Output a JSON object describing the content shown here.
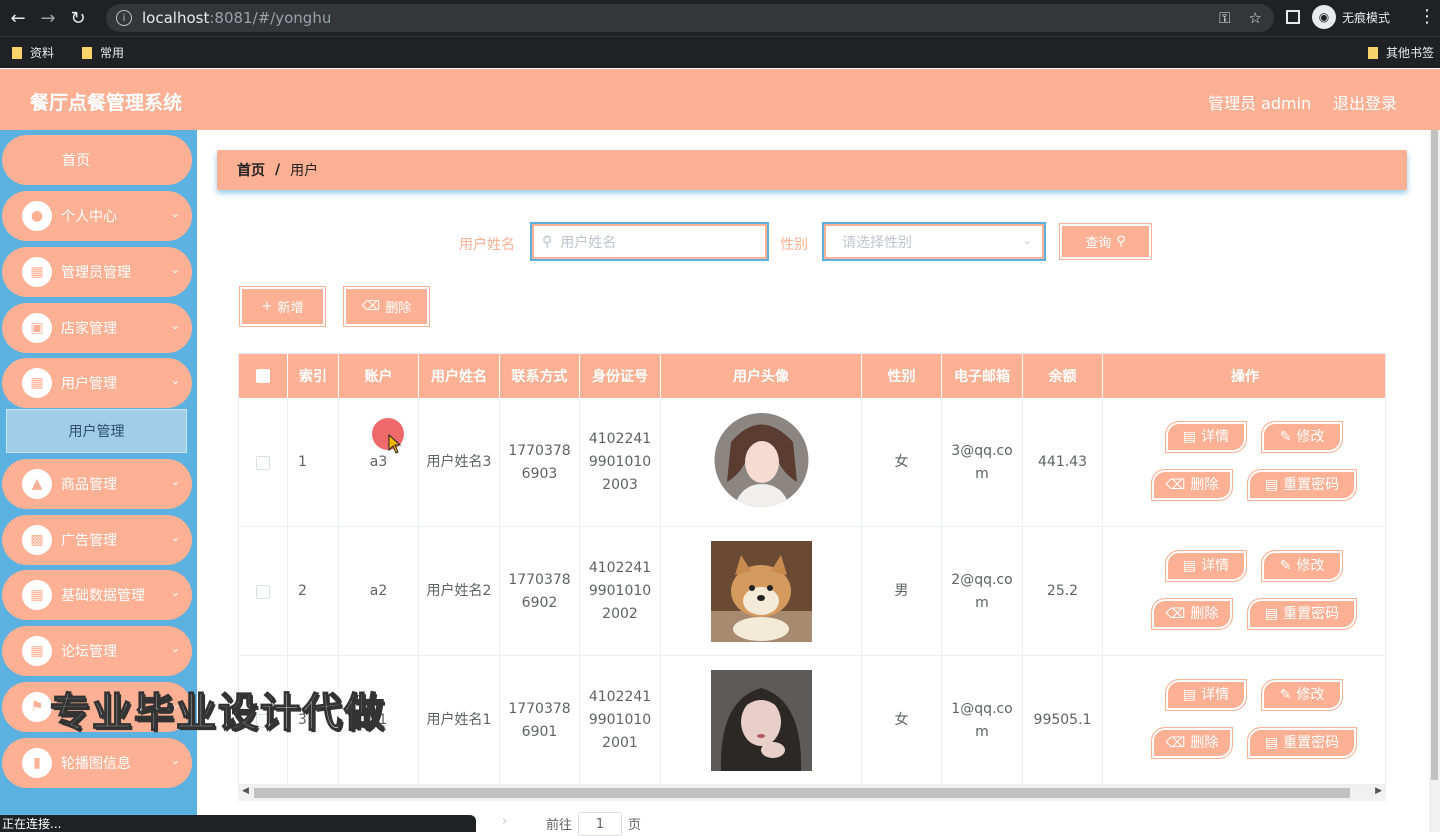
{
  "browser": {
    "url_host": "localhost",
    "url_rest": ":8081/#/yonghu",
    "incognito_label": "无痕模式",
    "bookmarks": [
      "资料",
      "常用"
    ],
    "other_bookmarks": "其他书签",
    "status_text": "正在连接..."
  },
  "header": {
    "title": "餐厅点餐管理系统",
    "user": "管理员 admin",
    "logout": "退出登录"
  },
  "sidebar": {
    "items": [
      {
        "label": "首页",
        "icon": "home-icon"
      },
      {
        "label": "个人中心",
        "icon": "user-icon"
      },
      {
        "label": "管理员管理",
        "icon": "grid-icon"
      },
      {
        "label": "店家管理",
        "icon": "shop-icon"
      },
      {
        "label": "用户管理",
        "icon": "grid-icon"
      },
      {
        "label": "商品管理",
        "icon": "ticket-icon"
      },
      {
        "label": "广告管理",
        "icon": "monitor-icon"
      },
      {
        "label": "基础数据管理",
        "icon": "grid-icon"
      },
      {
        "label": "论坛管理",
        "icon": "grid-icon"
      },
      {
        "label": "",
        "icon": "flag-icon"
      },
      {
        "label": "轮播图信息",
        "icon": "clipboard-icon"
      }
    ],
    "sub_item": "用户管理"
  },
  "breadcrumb": {
    "home": "首页",
    "sep": "/",
    "current": "用户"
  },
  "search": {
    "name_label": "用户姓名",
    "name_placeholder": "用户姓名",
    "gender_label": "性别",
    "gender_placeholder": "请选择性别",
    "query_button": "查询"
  },
  "actions": {
    "add": "新增",
    "delete": "删除"
  },
  "table": {
    "headers": [
      "索引",
      "账户",
      "用户姓名",
      "联系方式",
      "身份证号",
      "用户头像",
      "性别",
      "电子邮箱",
      "余额",
      "操作"
    ],
    "rows": [
      {
        "index": "1",
        "account": "a3",
        "name": "用户姓名3",
        "phone": "17703786903",
        "id_card": "410224199010102003",
        "gender": "女",
        "email": "3@qq.com",
        "balance": "441.43"
      },
      {
        "index": "2",
        "account": "a2",
        "name": "用户姓名2",
        "phone": "17703786902",
        "id_card": "410224199010102002",
        "gender": "男",
        "email": "2@qq.com",
        "balance": "25.2"
      },
      {
        "index": "3",
        "account": "a1",
        "name": "用户姓名1",
        "phone": "17703786901",
        "id_card": "410224199010102001",
        "gender": "女",
        "email": "1@qq.com",
        "balance": "99505.1"
      }
    ],
    "op_labels": {
      "detail": "详情",
      "edit": "修改",
      "delete": "删除",
      "reset": "重置密码"
    }
  },
  "pager": {
    "goto": "前往",
    "page": "1",
    "unit": "页"
  },
  "watermark": "专业毕业设计代做",
  "colors": {
    "accent": "#fdb094",
    "sidebar": "#5bb1df"
  }
}
